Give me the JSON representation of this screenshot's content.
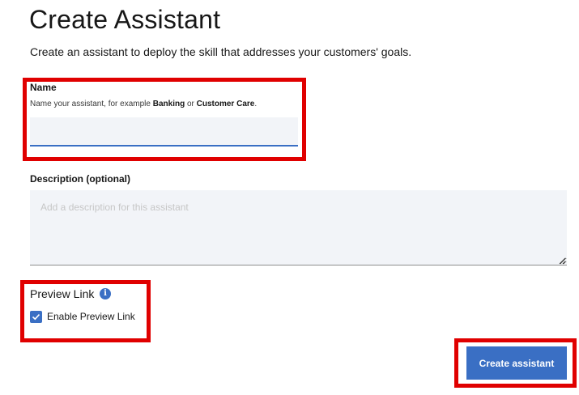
{
  "header": {
    "title": "Create Assistant",
    "subtitle": "Create an assistant to deploy the skill that addresses your customers' goals."
  },
  "name_field": {
    "label": "Name",
    "helper_prefix": "Name your assistant, for example ",
    "helper_example1": "Banking",
    "helper_or": " or ",
    "helper_example2": "Customer Care",
    "helper_suffix": ".",
    "value": "",
    "placeholder": ""
  },
  "description_field": {
    "label": "Description (optional)",
    "value": "",
    "placeholder": "Add a description for this assistant"
  },
  "preview_link": {
    "title": "Preview Link",
    "info_icon": "info-icon",
    "checkbox_label": "Enable Preview Link",
    "checked": true
  },
  "actions": {
    "create_label": "Create assistant"
  },
  "colors": {
    "accent": "#3a6fc4",
    "highlight": "#e00000",
    "field_bg": "#f2f4f8"
  }
}
